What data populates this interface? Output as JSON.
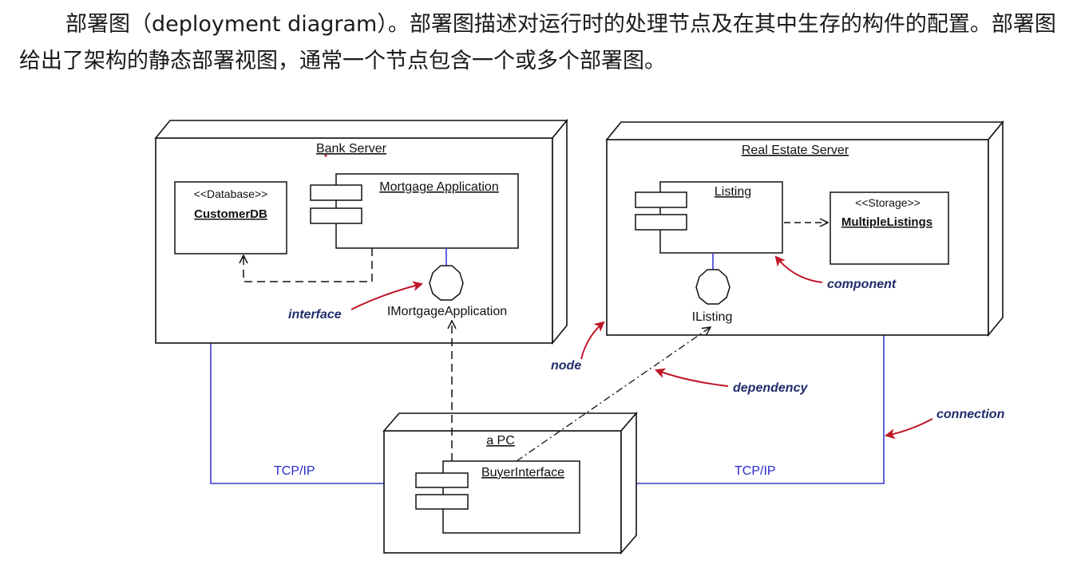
{
  "intro": {
    "text": "部署图（deployment diagram）。部署图描述对运行时的处理节点及在其中生存的构件的配置。部署图给出了架构的静态部署视图，通常一个节点包含一个或多个部署图。"
  },
  "diagram": {
    "nodes": {
      "bank_server": "Bank Server",
      "real_estate_server": "Real Estate Server",
      "pc": "a PC"
    },
    "components": {
      "customer_db_stereotype": "<<Database>>",
      "customer_db": "CustomerDB",
      "mortgage_application": "Mortgage Application",
      "listing": "Listing",
      "multiple_listings_stereotype": "<<Storage>>",
      "multiple_listings": "MultipleListings",
      "buyer_interface": "BuyerInterface"
    },
    "interfaces": {
      "imortgage": "IMortgageApplication",
      "ilisting": "IListing"
    },
    "connections": {
      "left": "TCP/IP",
      "right": "TCP/IP"
    },
    "annotations": {
      "interface": "interface",
      "component": "component",
      "node": "node",
      "dependency": "dependency",
      "connection": "connection"
    },
    "colors": {
      "connection_line": "#3a3ad0",
      "annotation_arrow": "#c0182a",
      "annotation_text": "#1f2c6b"
    }
  }
}
